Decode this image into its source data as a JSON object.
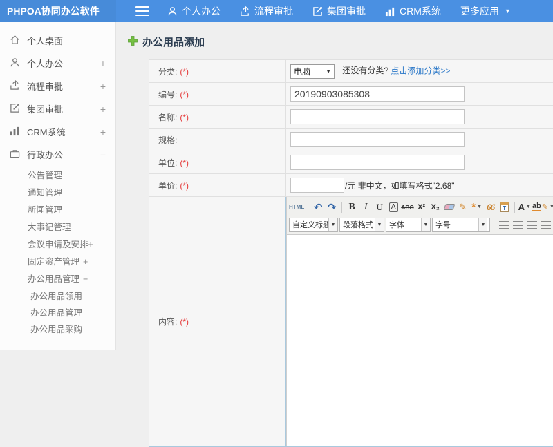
{
  "header": {
    "logo": "PHPOA协同办公软件",
    "nav": [
      {
        "label": "个人办公"
      },
      {
        "label": "流程审批"
      },
      {
        "label": "集团审批"
      },
      {
        "label": "CRM系统"
      },
      {
        "label": "更多应用"
      }
    ]
  },
  "sidebar": {
    "items": [
      {
        "label": "个人桌面",
        "toggle": ""
      },
      {
        "label": "个人办公",
        "toggle": "+"
      },
      {
        "label": "流程审批",
        "toggle": "+"
      },
      {
        "label": "集团审批",
        "toggle": "+"
      },
      {
        "label": "CRM系统",
        "toggle": "+"
      },
      {
        "label": "行政办公",
        "toggle": "−"
      }
    ],
    "admin_children": [
      {
        "label": "公告管理",
        "toggle": ""
      },
      {
        "label": "通知管理",
        "toggle": ""
      },
      {
        "label": "新闻管理",
        "toggle": ""
      },
      {
        "label": "大事记管理",
        "toggle": ""
      },
      {
        "label": "会议申请及安排",
        "toggle": "+"
      },
      {
        "label": "固定资产管理",
        "toggle": "+"
      },
      {
        "label": "办公用品管理",
        "toggle": "−"
      }
    ],
    "supplies_children": [
      {
        "label": "办公用品领用"
      },
      {
        "label": "办公用品管理"
      },
      {
        "label": "办公用品采购"
      }
    ]
  },
  "main": {
    "title": "办公用品添加",
    "form": {
      "category_label": "分类:",
      "category_required": "(*)",
      "category_value": "电脑",
      "category_hint": "还没有分类?",
      "category_link": "点击添加分类>>",
      "code_label": "编号:",
      "code_required": "(*)",
      "code_value": "20190903085308",
      "name_label": "名称:",
      "name_required": "(*)",
      "spec_label": "规格:",
      "unit_label": "单位:",
      "unit_required": "(*)",
      "price_label": "单价:",
      "price_required": "(*)",
      "price_suffix": "/元 非中文，如填写格式\"2.68\"",
      "content_label": "内容:",
      "content_required": "(*)"
    },
    "editor": {
      "html_button": "HTML",
      "undo": "↶",
      "redo": "↷",
      "bold": "B",
      "italic": "I",
      "underline": "U",
      "boxed_a": "A",
      "strike": "ABC",
      "superscript": "X²",
      "subscript": "X₂",
      "wand": "*",
      "quote": "66",
      "paste_t": "T",
      "color_a": "A",
      "highlight_ab": "ab",
      "pen": "✎",
      "link_glyph": "∞",
      "selects": [
        {
          "label": "自定义标题"
        },
        {
          "label": "段落格式"
        },
        {
          "label": "字体"
        },
        {
          "label": "字号"
        }
      ]
    }
  },
  "colors": {
    "header_blue": "#4a90e2",
    "link_blue": "#2b78c8",
    "required_red": "#e53c3c",
    "plus_green": "#76c043"
  }
}
